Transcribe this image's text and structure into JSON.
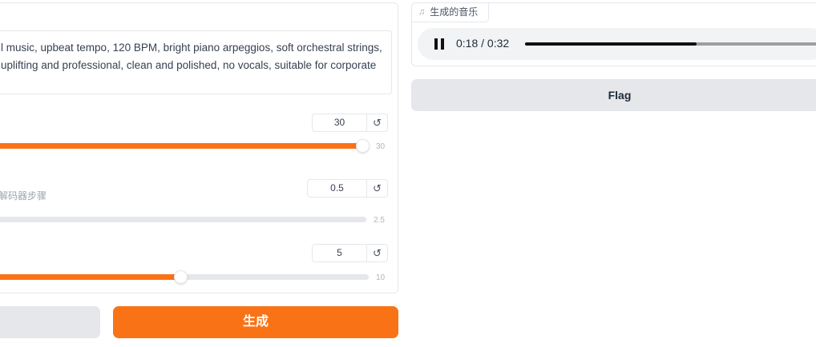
{
  "prompt": {
    "line1": "l music, upbeat tempo, 120 BPM, bright piano arpeggios, soft orchestral strings,",
    "line2": "uplifting and professional, clean and polished, no vocals, suitable for corporate"
  },
  "sliders": [
    {
      "value": "30",
      "max_label": "30",
      "level": 1.0
    },
    {
      "value": "0.5",
      "max_label": "2.5",
      "sub_label": "解码器步骤",
      "level": 0.0
    },
    {
      "value": "5",
      "max_label": "10",
      "level": 0.5
    }
  ],
  "reset_icon": "↺",
  "buttons": {
    "generate": "生成",
    "flag": "Flag"
  },
  "audio": {
    "label": "生成的音乐",
    "label_icon": "music-note-icon",
    "time": "0:18 / 0:32",
    "progress": 0.5625
  },
  "colors": {
    "accent": "#f97316",
    "track": "#e5e7eb"
  }
}
